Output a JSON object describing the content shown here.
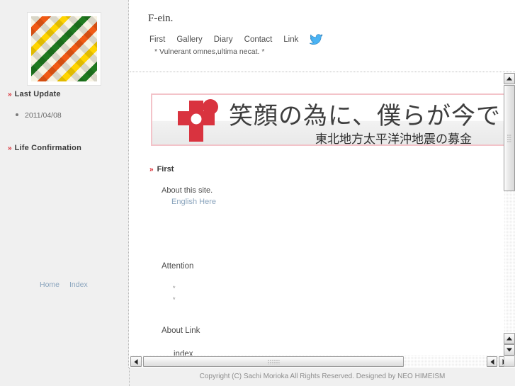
{
  "sidebar": {
    "logo_alt": "diagonal-stripe-logo",
    "sections": [
      {
        "marker": "»",
        "label": "Last Update"
      },
      {
        "marker": "»",
        "label": "Life Confirmation"
      }
    ],
    "last_update_date": "2011/04/08",
    "links": [
      {
        "label": "Home"
      },
      {
        "label": "Index"
      }
    ]
  },
  "header": {
    "site_title": "F-ein.",
    "nav": [
      {
        "label": "First"
      },
      {
        "label": "Gallery"
      },
      {
        "label": "Diary"
      },
      {
        "label": "Contact"
      },
      {
        "label": "Link"
      }
    ],
    "twitter_icon": "twitter-bird-icon",
    "tagline": "* Vulnerant omnes,ultima necat. *"
  },
  "banner": {
    "icon": "red-cross-icon",
    "headline": "笑顔の為に、僕らが今でき",
    "subline": "東北地方太平洋沖地震の募金",
    "border_color": "#f3c3c9",
    "cross_color": "#d9333f"
  },
  "content": {
    "section_marker": "»",
    "section_title": "First",
    "about_text": "About this site.",
    "english_link": "English Here",
    "attention_title": "Attention",
    "attention_items": [
      "*",
      "*"
    ],
    "about_link_title": "About Link",
    "index_text": "index"
  },
  "scrollbars": {
    "vertical_up_icon": "scroll-up-arrow-icon",
    "vertical_down_icon": "scroll-down-arrow-icon",
    "horizontal_left_icon": "scroll-left-arrow-icon",
    "horizontal_right_icon": "scroll-right-arrow-icon"
  },
  "footer": {
    "copyright": "Copyright (C) Sachi Morioka All Rights Reserved. Designed by NEO HIMEISM"
  }
}
